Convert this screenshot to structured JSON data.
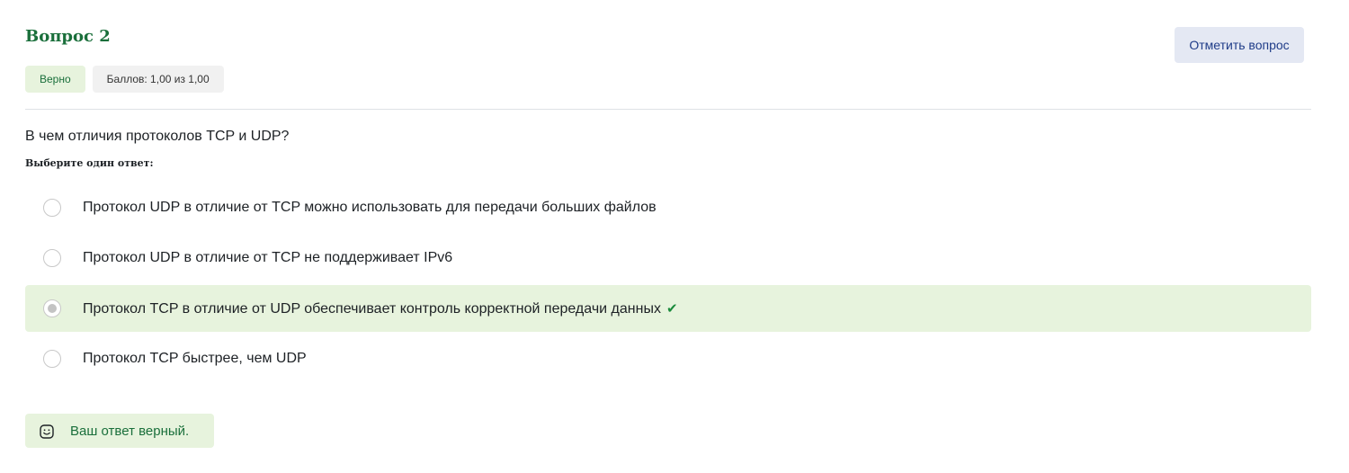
{
  "question": {
    "title": "Вопрос 2",
    "flag_button": "Отметить вопрос",
    "status_badge": "Верно",
    "score_badge": "Баллов: 1,00 из 1,00",
    "text": "В чем отличия протоколов TCP и UDP?",
    "prompt": "Выберите один ответ:"
  },
  "answers": [
    {
      "label": "Протокол UDP в отличие от TCP можно использовать для передачи больших файлов",
      "selected": false,
      "correct": false
    },
    {
      "label": "Протокол UDP в отличие от TCP не поддерживает IPv6",
      "selected": false,
      "correct": false
    },
    {
      "label": "Протокол TCP в отличие от UDP обеспечивает контроль корректной передачи данных",
      "selected": true,
      "correct": true
    },
    {
      "label": "Протокол TCP быстрее, чем UDP",
      "selected": false,
      "correct": false
    }
  ],
  "feedback": {
    "text": "Ваш ответ верный.",
    "icon": "smile-icon"
  },
  "colors": {
    "accent_green": "#1a6f3b",
    "correct_bg": "#e7f3dd",
    "flag_bg": "#e4e8f3",
    "flag_text": "#1f3c88"
  }
}
